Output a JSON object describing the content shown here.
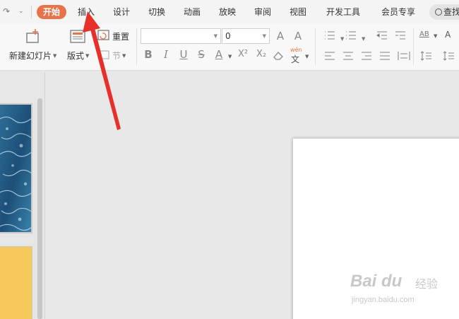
{
  "tabs": [
    {
      "label": "开始",
      "active": true
    },
    {
      "label": "插入"
    },
    {
      "label": "设计"
    },
    {
      "label": "切换"
    },
    {
      "label": "动画"
    },
    {
      "label": "放映"
    },
    {
      "label": "审阅"
    },
    {
      "label": "视图"
    },
    {
      "label": "开发工具"
    },
    {
      "label": "会员专享"
    }
  ],
  "search": {
    "label": "查找",
    "icon": "search-icon"
  },
  "ribbon": {
    "new_slide": "新建幻灯片",
    "layout": "版式",
    "reset": "重置",
    "section": "节",
    "font_name": "",
    "font_size": "0",
    "grow_font": "A",
    "shrink_font": "A",
    "bold": "B",
    "italic": "I",
    "underline": "U",
    "strike": "S",
    "font_color": "A",
    "superscript": "X²",
    "subscript": "X₂",
    "phonetic_top": "wén",
    "phonetic_bottom": "文",
    "text_dir": "AB",
    "line_spacing": "A"
  },
  "watermark": {
    "brand": "Bai du",
    "brand_cn": "经验",
    "url": "jingyan.baidu.com"
  },
  "colors": {
    "accent": "#e8734b",
    "arrow": "#e8302a"
  }
}
